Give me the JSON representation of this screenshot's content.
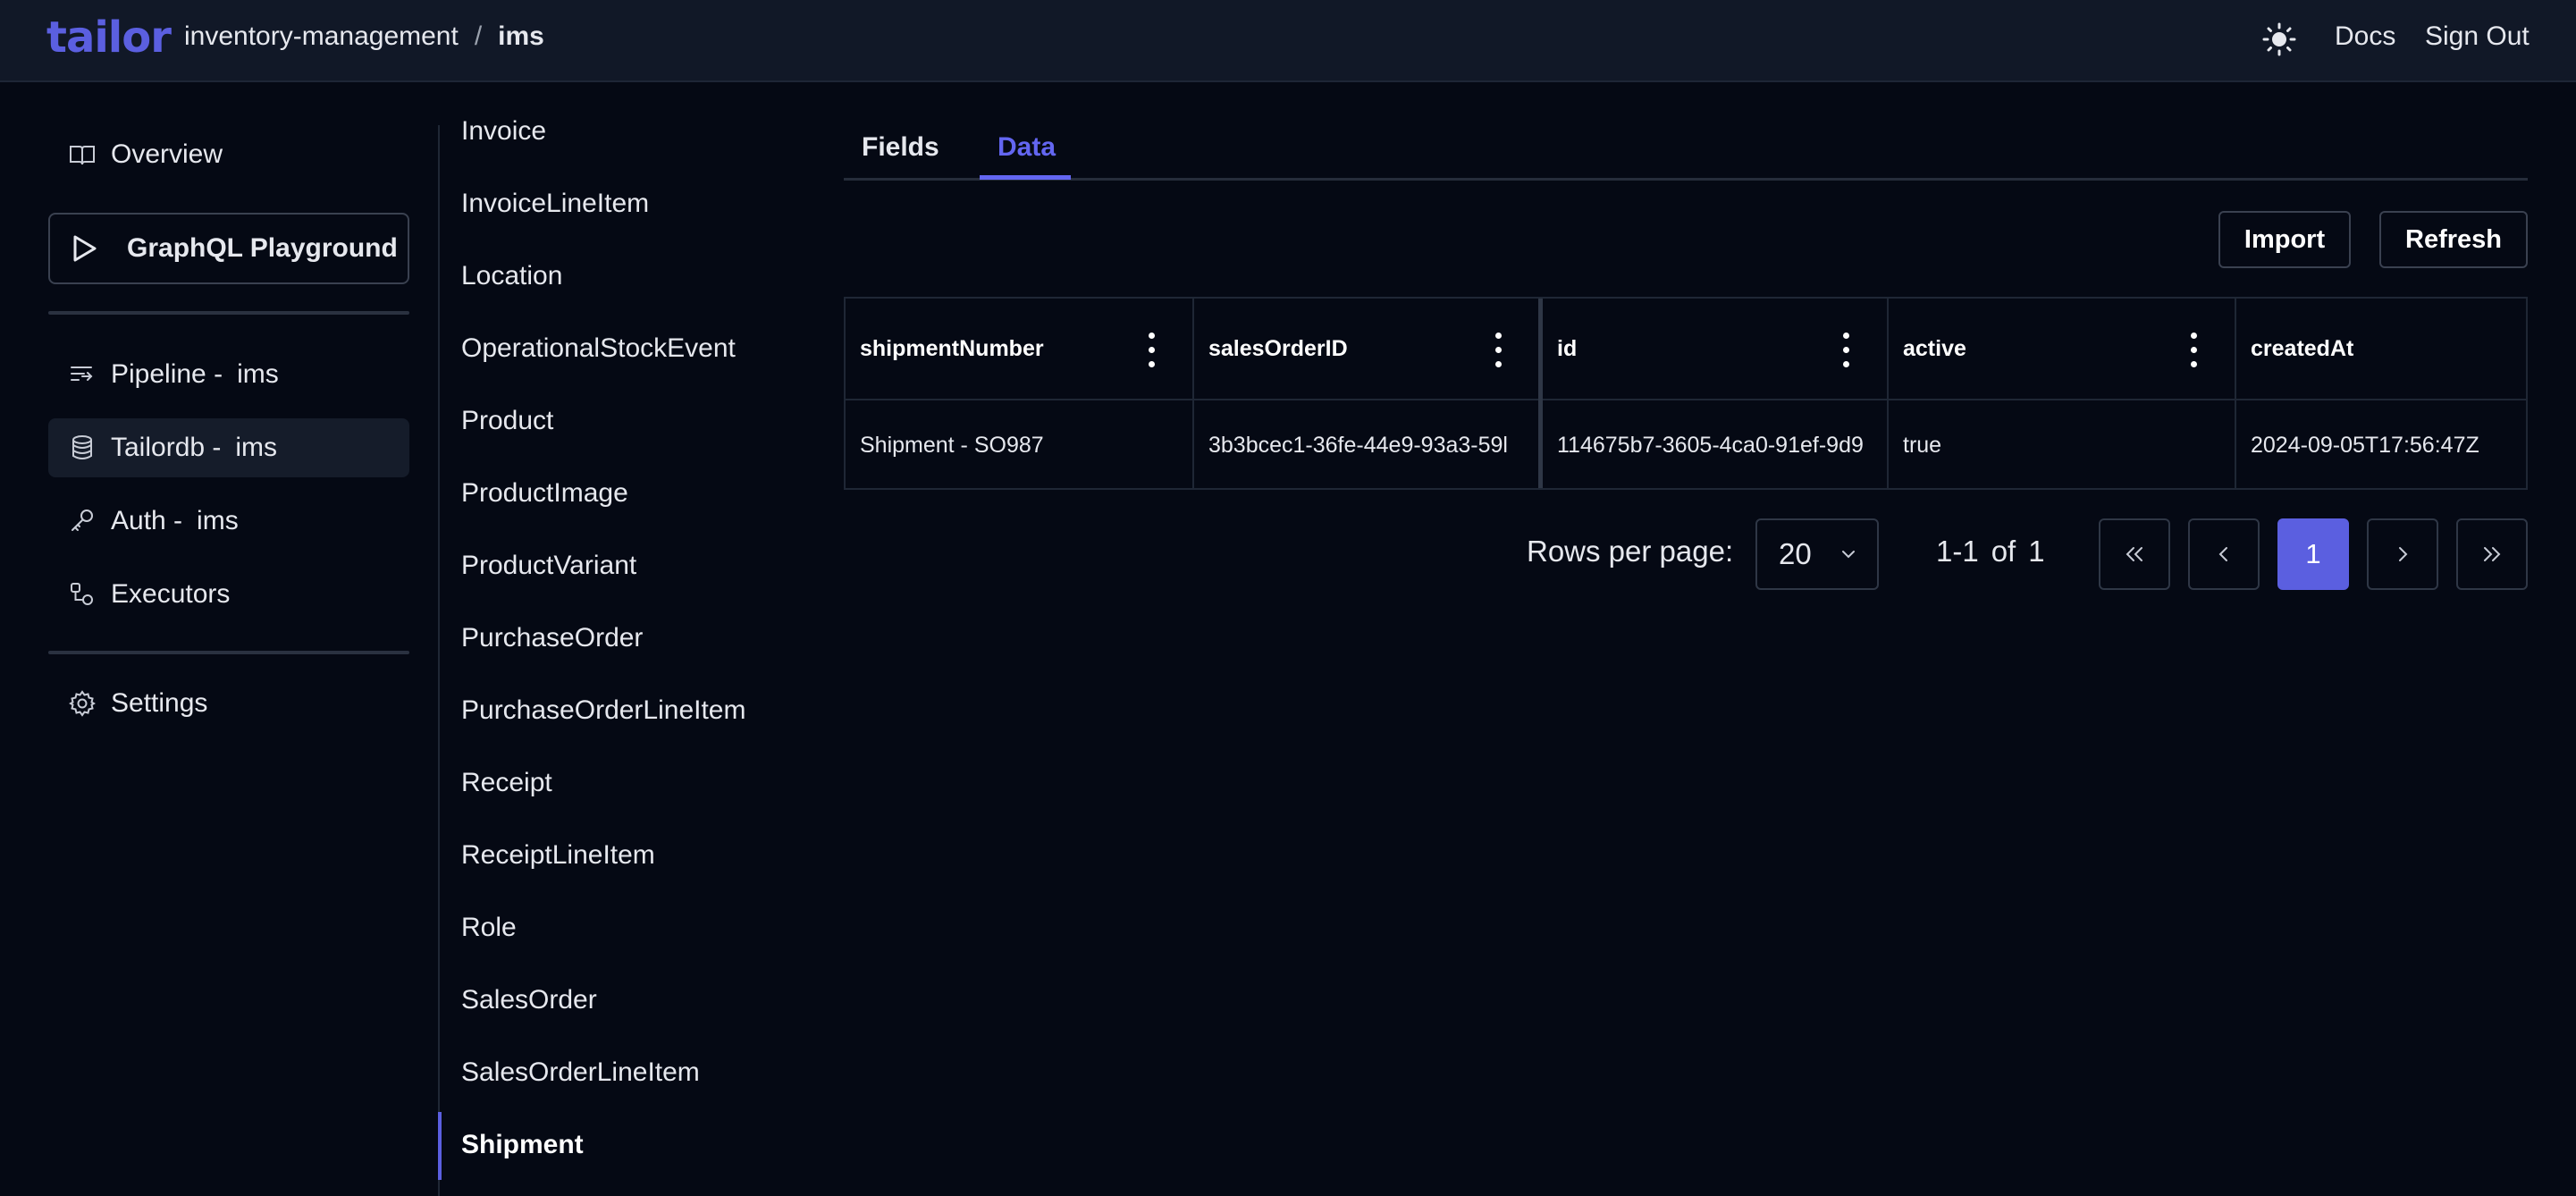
{
  "header": {
    "logo": "tailor",
    "breadcrumb": [
      "inventory-management",
      "/",
      "ims"
    ],
    "docs_label": "Docs",
    "signout_label": "Sign Out",
    "theme_icon": "sun-icon"
  },
  "sidebar": {
    "overview": "Overview",
    "graphql_playground": "GraphQL Playground",
    "pipeline": {
      "label": "Pipeline -",
      "sub": "ims"
    },
    "tailordb": {
      "label": "Tailordb -",
      "sub": "ims"
    },
    "auth": {
      "label": "Auth -",
      "sub": "ims"
    },
    "executors": "Executors",
    "settings": "Settings",
    "active_item": "tailordb"
  },
  "types": {
    "items": [
      "Invoice",
      "InvoiceLineItem",
      "Location",
      "OperationalStockEvent",
      "Product",
      "ProductImage",
      "ProductVariant",
      "PurchaseOrder",
      "PurchaseOrderLineItem",
      "Receipt",
      "ReceiptLineItem",
      "Role",
      "SalesOrder",
      "SalesOrderLineItem",
      "Shipment"
    ],
    "selected": "Shipment"
  },
  "tabs": {
    "fields": "Fields",
    "data": "Data",
    "active": "Data"
  },
  "toolbar": {
    "import_label": "Import",
    "refresh_label": "Refresh"
  },
  "table": {
    "columns": [
      "shipmentNumber",
      "salesOrderID",
      "id",
      "active",
      "createdAt"
    ],
    "rows": [
      [
        "Shipment - SO987",
        "3b3bcec1-36fe-44e9-93a3-59l",
        "114675b7-3605-4ca0-91ef-9d9",
        "true",
        "2024-09-05T17:56:47Z"
      ]
    ]
  },
  "pagination": {
    "rows_per_page_label": "Rows per page:",
    "rows_per_page_value": "20",
    "range": "1-1",
    "of_label": "of",
    "total": "1",
    "current_page": "1"
  },
  "colors": {
    "accent": "#5b5fe0",
    "background": "#050914",
    "header": "#111827"
  }
}
